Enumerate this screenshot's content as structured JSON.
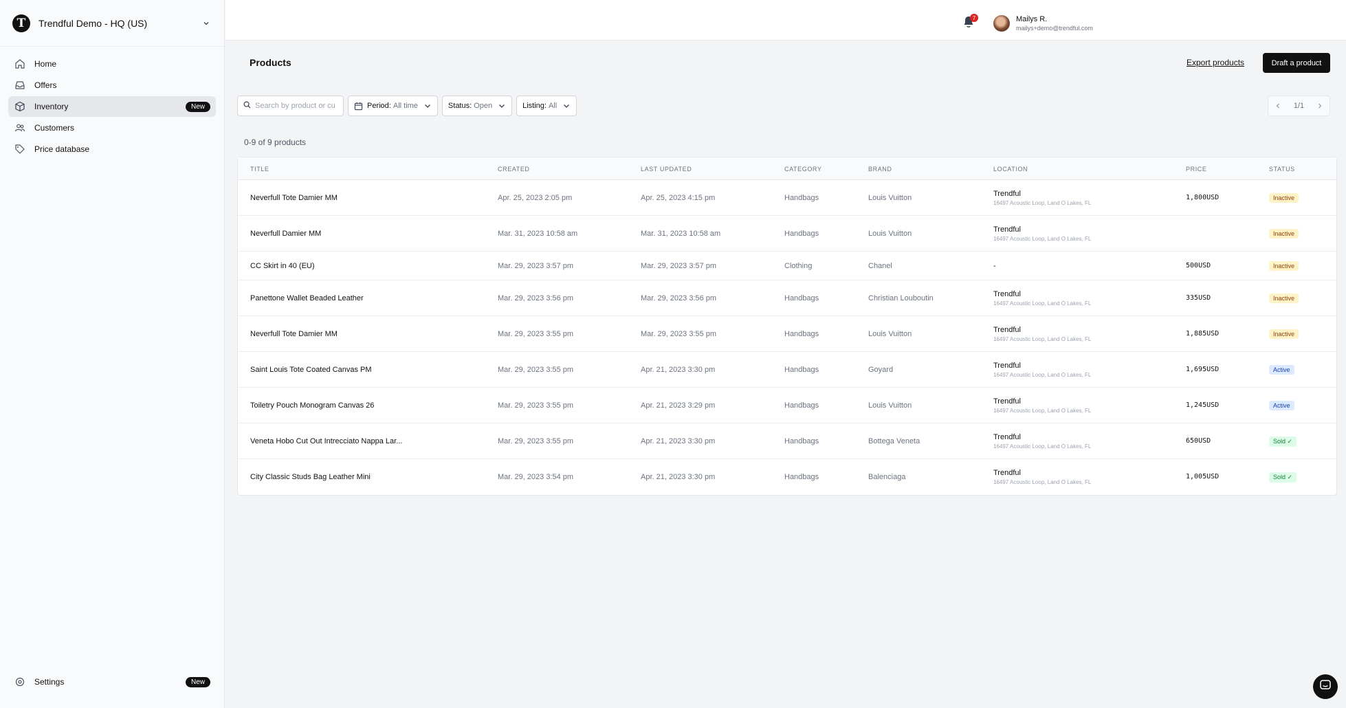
{
  "org": {
    "initial": "T",
    "name": "Trendful Demo - HQ (US)"
  },
  "nav": {
    "items": [
      {
        "label": "Home",
        "icon": "home-icon"
      },
      {
        "label": "Offers",
        "icon": "inbox-icon"
      },
      {
        "label": "Inventory",
        "icon": "box-icon",
        "badge": "New",
        "active": true
      },
      {
        "label": "Customers",
        "icon": "users-icon"
      },
      {
        "label": "Price database",
        "icon": "tag-icon"
      }
    ],
    "settings": {
      "label": "Settings",
      "badge": "New",
      "icon": "gear-icon"
    }
  },
  "topbar": {
    "notification_count": "7",
    "user_name": "Mailys R.",
    "user_email": "mailys+demo@trendful.com"
  },
  "page": {
    "title": "Products",
    "export_label": "Export products",
    "draft_label": "Draft a product"
  },
  "filters": {
    "search_placeholder": "Search by product or cu",
    "period": {
      "key": "Period:",
      "value": "All time"
    },
    "status": {
      "key": "Status:",
      "value": "Open"
    },
    "listing": {
      "key": "Listing:",
      "value": "All"
    }
  },
  "pagination": {
    "text": "1/1"
  },
  "count_text": "0-9 of 9 products",
  "table": {
    "columns": [
      "Title",
      "Created",
      "Last updated",
      "Category",
      "Brand",
      "Location",
      "Price",
      "Status"
    ],
    "rows": [
      {
        "title": "Neverfull Tote Damier MM",
        "created": "Apr. 25, 2023 2:05 pm",
        "updated": "Apr. 25, 2023 4:15 pm",
        "category": "Handbags",
        "brand": "Louis Vuitton",
        "location": "Trendful",
        "address": "16497 Acoustic Loop, Land O Lakes, FL",
        "price": "1,800",
        "currency": "USD",
        "status": "Inactive",
        "status_kind": "inactive"
      },
      {
        "title": "Neverfull Damier MM",
        "created": "Mar. 31, 2023 10:58 am",
        "updated": "Mar. 31, 2023 10:58 am",
        "category": "Handbags",
        "brand": "Louis Vuitton",
        "location": "Trendful",
        "address": "16497 Acoustic Loop, Land O Lakes, FL",
        "price": "",
        "currency": "",
        "status": "Inactive",
        "status_kind": "inactive"
      },
      {
        "title": "CC Skirt in 40 (EU)",
        "created": "Mar. 29, 2023 3:57 pm",
        "updated": "Mar. 29, 2023 3:57 pm",
        "category": "Clothing",
        "brand": "Chanel",
        "location": "-",
        "address": "",
        "price": "500",
        "currency": "USD",
        "status": "Inactive",
        "status_kind": "inactive"
      },
      {
        "title": "Panettone Wallet Beaded Leather",
        "created": "Mar. 29, 2023 3:56 pm",
        "updated": "Mar. 29, 2023 3:56 pm",
        "category": "Handbags",
        "brand": "Christian Louboutin",
        "location": "Trendful",
        "address": "16497 Acoustic Loop, Land O Lakes, FL",
        "price": "335",
        "currency": "USD",
        "status": "Inactive",
        "status_kind": "inactive"
      },
      {
        "title": "Neverfull Tote Damier MM",
        "created": "Mar. 29, 2023 3:55 pm",
        "updated": "Mar. 29, 2023 3:55 pm",
        "category": "Handbags",
        "brand": "Louis Vuitton",
        "location": "Trendful",
        "address": "16497 Acoustic Loop, Land O Lakes, FL",
        "price": "1,885",
        "currency": "USD",
        "status": "Inactive",
        "status_kind": "inactive"
      },
      {
        "title": "Saint Louis Tote Coated Canvas PM",
        "created": "Mar. 29, 2023 3:55 pm",
        "updated": "Apr. 21, 2023 3:30 pm",
        "category": "Handbags",
        "brand": "Goyard",
        "location": "Trendful",
        "address": "16497 Acoustic Loop, Land O Lakes, FL",
        "price": "1,695",
        "currency": "USD",
        "status": "Active",
        "status_kind": "active"
      },
      {
        "title": "Toiletry Pouch Monogram Canvas 26",
        "created": "Mar. 29, 2023 3:55 pm",
        "updated": "Apr. 21, 2023 3:29 pm",
        "category": "Handbags",
        "brand": "Louis Vuitton",
        "location": "Trendful",
        "address": "16497 Acoustic Loop, Land O Lakes, FL",
        "price": "1,245",
        "currency": "USD",
        "status": "Active",
        "status_kind": "active"
      },
      {
        "title": "Veneta Hobo Cut Out Intrecciato Nappa Lar...",
        "created": "Mar. 29, 2023 3:55 pm",
        "updated": "Apr. 21, 2023 3:30 pm",
        "category": "Handbags",
        "brand": "Bottega Veneta",
        "location": "Trendful",
        "address": "16497 Acoustic Loop, Land O Lakes, FL",
        "price": "650",
        "currency": "USD",
        "status": "Sold ✓",
        "status_kind": "sold"
      },
      {
        "title": "City Classic Studs Bag Leather Mini",
        "created": "Mar. 29, 2023 3:54 pm",
        "updated": "Apr. 21, 2023 3:30 pm",
        "category": "Handbags",
        "brand": "Balenciaga",
        "location": "Trendful",
        "address": "16497 Acoustic Loop, Land O Lakes, FL",
        "price": "1,005",
        "currency": "USD",
        "status": "Sold ✓",
        "status_kind": "sold"
      }
    ]
  },
  "colors": {
    "primary": "#111111",
    "inactive_bg": "#fef3c7",
    "active_bg": "#dbeafe",
    "sold_bg": "#dcfce7",
    "notification": "#dc2626"
  }
}
